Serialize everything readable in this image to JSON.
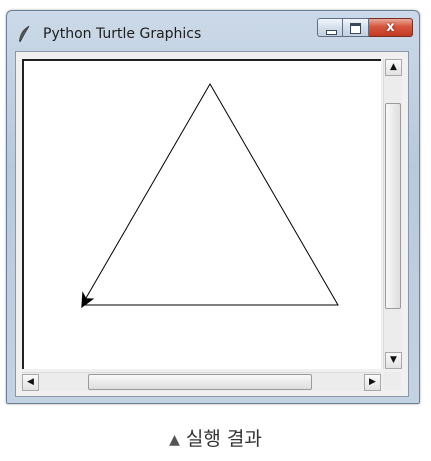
{
  "window": {
    "title": "Python Turtle Graphics",
    "close_glyph": "x"
  },
  "scrollbars": {
    "up_arrow": "▲",
    "down_arrow": "▼",
    "left_arrow": "◀",
    "right_arrow": "▶"
  },
  "drawing": {
    "shape": "triangle",
    "stroke_color": "#000000",
    "turtle_cursor": "arrow"
  },
  "caption": {
    "marker": "▲",
    "text": "실행 결과"
  }
}
